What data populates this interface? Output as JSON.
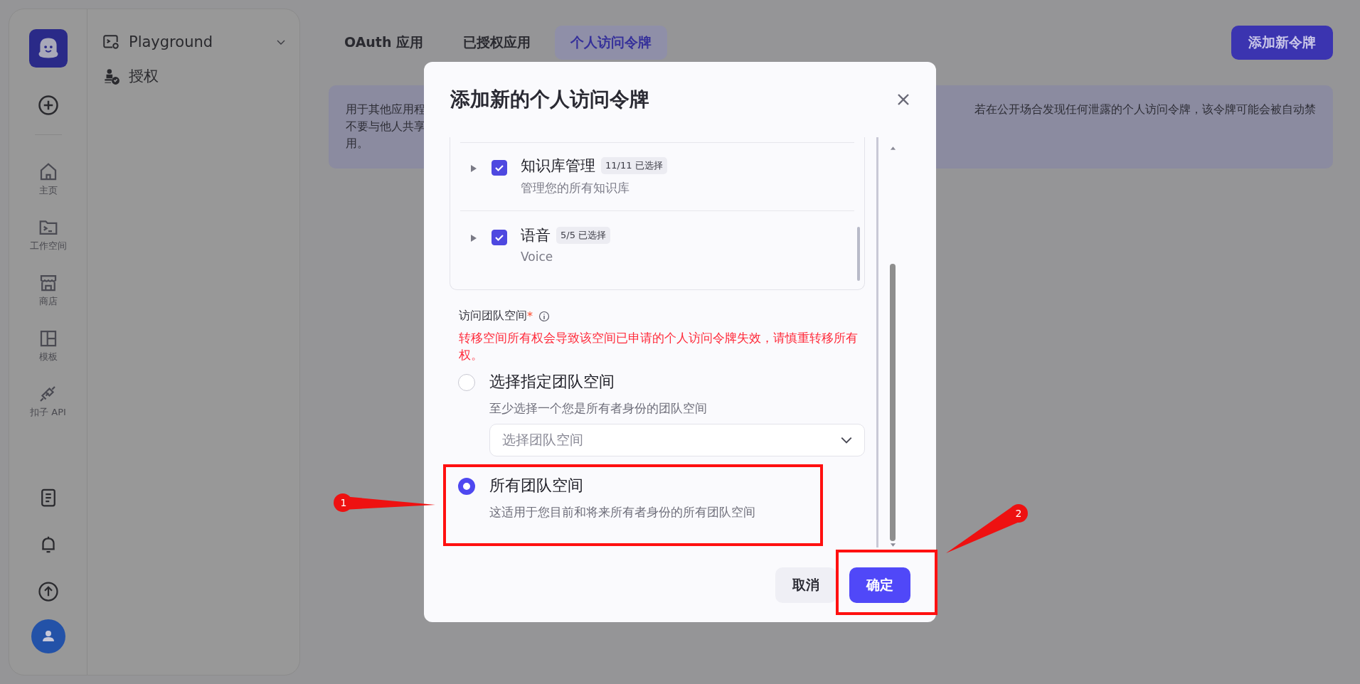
{
  "sidebar": {
    "nav": [
      {
        "label": "主页"
      },
      {
        "label": "工作空间"
      },
      {
        "label": "商店"
      },
      {
        "label": "模板"
      },
      {
        "label": "扣子 API"
      }
    ]
  },
  "subnav": [
    {
      "label": "Playground",
      "kind": "group"
    },
    {
      "label": "授权",
      "kind": "link"
    }
  ],
  "tabs": [
    {
      "label": "OAuth 应用",
      "selected": false
    },
    {
      "label": "已授权应用",
      "selected": false
    },
    {
      "label": "个人访问令牌",
      "selected": true
    }
  ],
  "add_button": "添加新令牌",
  "banner": {
    "left_lines": [
      "用于其他应用程",
      "不要与他人共享",
      "用。"
    ],
    "right_lines": [
      "若在公开场合发现任何泄露的个人访问令牌，该令牌可能会被自动禁"
    ]
  },
  "dialog": {
    "title": "添加新的个人访问令牌",
    "permissions": [
      {
        "name": "知识库管理",
        "badge": "11/11 已选择",
        "description": "管理您的所有知识库",
        "checked": true
      },
      {
        "name": "语音",
        "badge": "5/5 已选择",
        "description": "Voice",
        "checked": true
      }
    ],
    "team": {
      "label": "访问团队空间",
      "required_mark": "*",
      "warning": "转移空间所有权会导致该空间已申请的个人访问令牌失效，请慎重转移所有权。",
      "options": [
        {
          "label": "选择指定团队空间",
          "description": "至少选择一个您是所有者身份的团队空间",
          "selected": false,
          "kind": "select",
          "placeholder": "选择团队空间"
        },
        {
          "label": "所有团队空间",
          "description": "这适用于您目前和将来所有者身份的所有团队空间",
          "selected": true,
          "kind": "plain"
        }
      ]
    },
    "buttons": [
      {
        "label": "取消",
        "kind": "secondary"
      },
      {
        "label": "确定",
        "kind": "primary"
      }
    ]
  },
  "annotations": [
    {
      "number": "1"
    },
    {
      "number": "2"
    }
  ]
}
